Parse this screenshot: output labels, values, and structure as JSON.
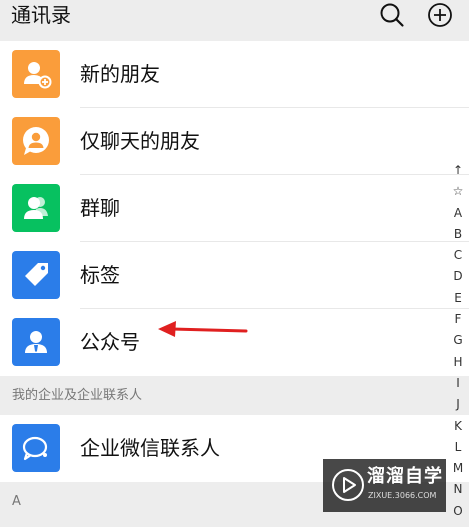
{
  "header": {
    "title": "通讯录"
  },
  "menu": [
    {
      "label": "新的朋友",
      "icon": "add-friend-icon",
      "color": "#fa9d3b"
    },
    {
      "label": "仅聊天的朋友",
      "icon": "chat-only-friend-icon",
      "color": "#fa9d3b"
    },
    {
      "label": "群聊",
      "icon": "group-chat-icon",
      "color": "#07c160"
    },
    {
      "label": "标签",
      "icon": "tag-icon",
      "color": "#2b7de9"
    },
    {
      "label": "公众号",
      "icon": "official-account-icon",
      "color": "#2b7de9"
    }
  ],
  "enterprise_section": {
    "title": "我的企业及企业联系人",
    "items": [
      {
        "label": "企业微信联系人",
        "icon": "wecom-contacts-icon",
        "color": "#2b7de9"
      }
    ]
  },
  "letter_section": {
    "title": "A"
  },
  "index": [
    "↑",
    "☆",
    "A",
    "B",
    "C",
    "D",
    "E",
    "F",
    "G",
    "H",
    "I",
    "J",
    "K",
    "L",
    "M",
    "N",
    "O"
  ],
  "annotation": {
    "arrow_color": "#e02020"
  },
  "watermark": {
    "title": "溜溜自学",
    "subtitle": "ZIXUE.3066.COM"
  }
}
